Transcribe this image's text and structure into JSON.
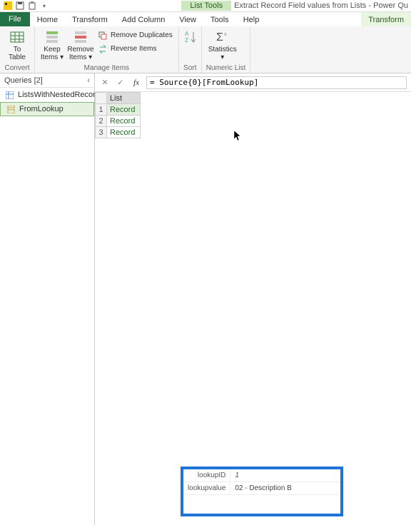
{
  "window": {
    "context_tab": "List Tools",
    "title": "Extract Record Field values from Lists - Power Qu"
  },
  "tabs": {
    "file": "File",
    "home": "Home",
    "transform": "Transform",
    "add_column": "Add Column",
    "view": "View",
    "tools": "Tools",
    "help": "Help",
    "transform_ctx": "Transform"
  },
  "ribbon": {
    "convert": {
      "to_table": "To\nTable",
      "group": "Convert"
    },
    "manage": {
      "keep": "Keep\nItems ▾",
      "remove": "Remove\nItems ▾",
      "remove_dup": "Remove Duplicates",
      "reverse": "Reverse Items",
      "group": "Manage Items"
    },
    "sort": {
      "group": "Sort"
    },
    "numeric": {
      "stats": "Statistics\n▾",
      "group": "Numeric List"
    }
  },
  "queries": {
    "header": "Queries [2]",
    "items": [
      {
        "label": "ListsWithNestedRecords"
      },
      {
        "label": "FromLookup"
      }
    ]
  },
  "formula": {
    "fx": "fx",
    "value": "= Source{0}[FromLookup]"
  },
  "grid": {
    "col": "List",
    "rows": [
      {
        "n": "1",
        "v": "Record"
      },
      {
        "n": "2",
        "v": "Record"
      },
      {
        "n": "3",
        "v": "Record"
      }
    ]
  },
  "record": {
    "k1": "lookupID",
    "v1": "1",
    "k2": "lookupvalue",
    "v2": "02 - Description B"
  }
}
